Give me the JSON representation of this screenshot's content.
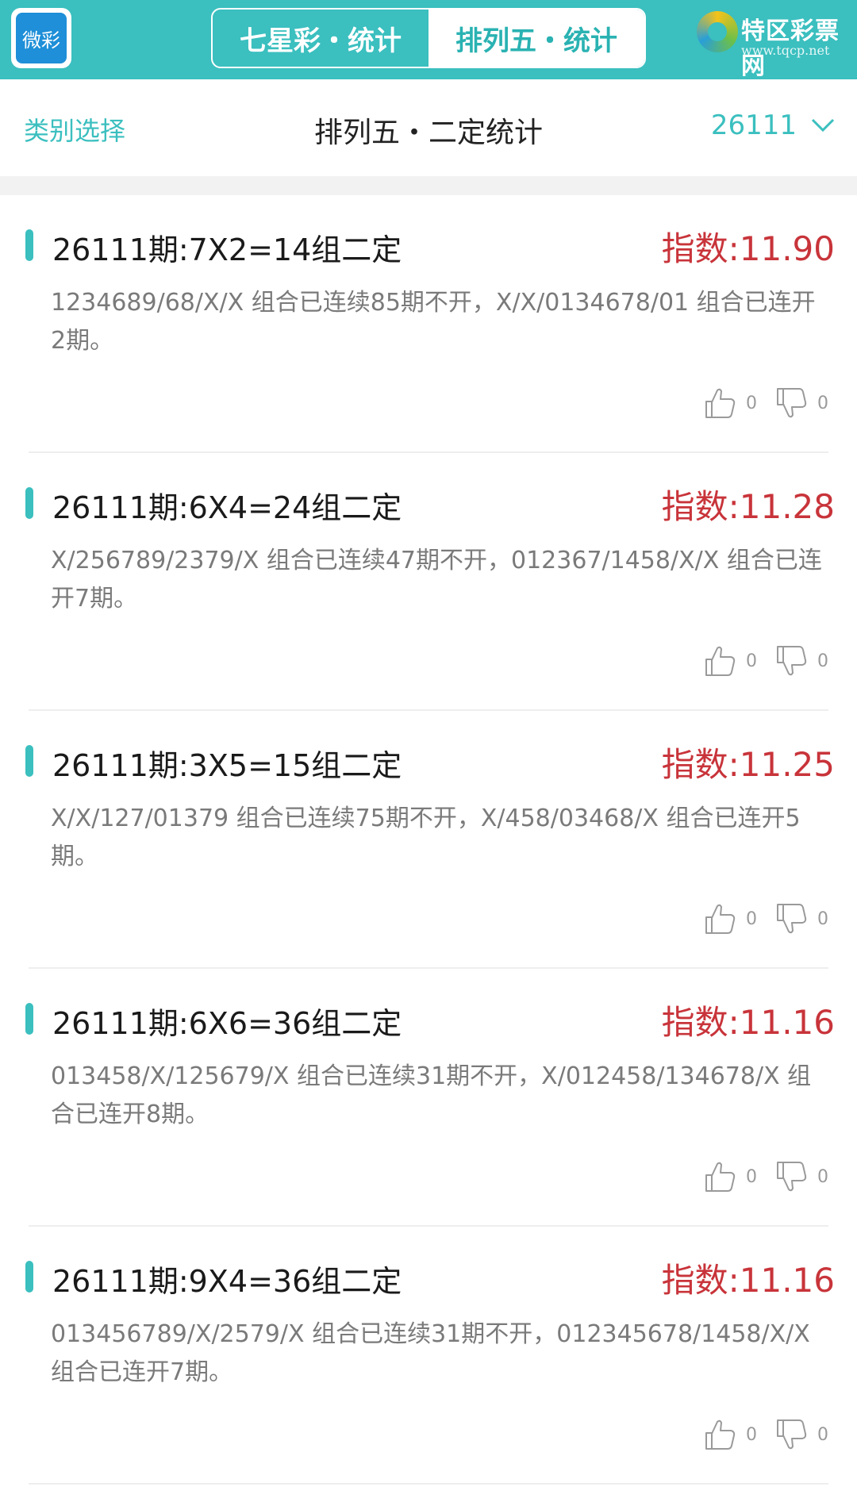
{
  "header": {
    "app_logo_text": "微彩",
    "tabs": [
      {
        "label": "七星彩・统计",
        "active": false
      },
      {
        "label": "排列五・统计",
        "active": true
      }
    ],
    "brand_name": "特区彩票网",
    "brand_url": "www.tqcp.net"
  },
  "subheader": {
    "category_select": "类别选择",
    "title": "排列五・二定统计",
    "issue": "26111"
  },
  "colors": {
    "accent": "#3bbfbf",
    "index_red": "#c8343a"
  },
  "items": [
    {
      "title": "26111期:7X2=14组二定",
      "index": "指数:11.90",
      "desc": "1234689/68/X/X 组合已连续85期不开，X/X/0134678/01 组合已连开2期。",
      "likes": "0",
      "dislikes": "0"
    },
    {
      "title": "26111期:6X4=24组二定",
      "index": "指数:11.28",
      "desc": "X/256789/2379/X 组合已连续47期不开，012367/1458/X/X 组合已连开7期。",
      "likes": "0",
      "dislikes": "0"
    },
    {
      "title": "26111期:3X5=15组二定",
      "index": "指数:11.25",
      "desc": "X/X/127/01379 组合已连续75期不开，X/458/03468/X 组合已连开5期。",
      "likes": "0",
      "dislikes": "0"
    },
    {
      "title": "26111期:6X6=36组二定",
      "index": "指数:11.16",
      "desc": "013458/X/125679/X 组合已连续31期不开，X/012458/134678/X 组合已连开8期。",
      "likes": "0",
      "dislikes": "0"
    },
    {
      "title": "26111期:9X4=36组二定",
      "index": "指数:11.16",
      "desc": "013456789/X/2579/X 组合已连续31期不开，012345678/1458/X/X 组合已连开7期。",
      "likes": "0",
      "dislikes": "0"
    }
  ]
}
